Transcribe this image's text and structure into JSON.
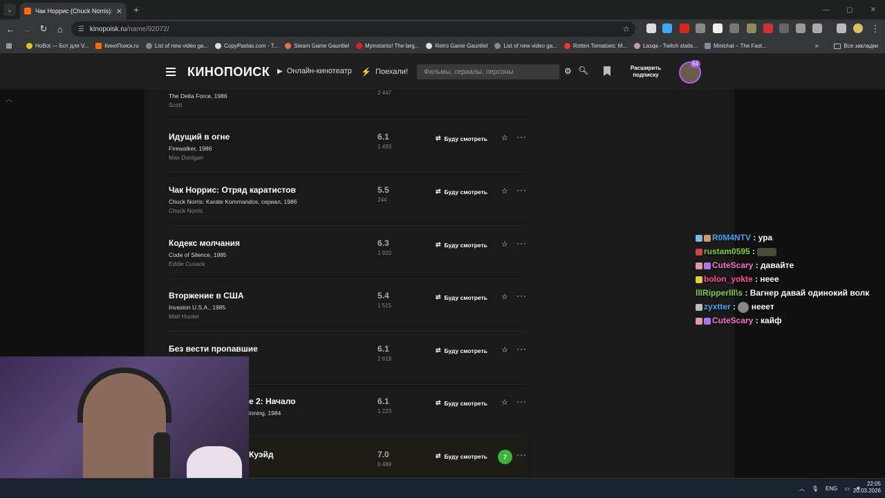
{
  "browser": {
    "tab_title": "Чак Норрис (Chuck Norris): ф",
    "tab_close": "✕",
    "new_tab": "+",
    "url_domain": "kinopoisk.ru",
    "url_path": "/name/92072/",
    "window_controls": [
      "—",
      "▢",
      "✕"
    ],
    "bookmarks": [
      "HoBot — Бот для V...",
      "КиноПоиск.ru",
      "List of new video ga...",
      "CopyPastas.com - T...",
      "Steam Game Gauntlet",
      "Myinstants! The larg...",
      "Retro Game Gauntlet",
      "List of new video ga...",
      "Rotten Tomatoes: M...",
      "Lasqa - Twitch statis...",
      "Minichat – The Fast..."
    ],
    "bookmarks_more": "»",
    "all_bookmarks": "Все закладки"
  },
  "site": {
    "logo": "КИНОПОИСК",
    "nav_online": "Онлайн-кинотеатр",
    "nav_go": "Поехали!",
    "search_placeholder": "Фильмы, сериалы, персоны",
    "subscribe_line1": "Расширить",
    "subscribe_line2": "подписку",
    "avatar_badge": "64"
  },
  "films_partial_top": {
    "orig": "The Delta Force, 1986",
    "role": "Scott",
    "votes": "2 447"
  },
  "films": [
    {
      "title": "Идущий в огне",
      "orig": "Firewalker, 1986",
      "role": "Max Donigan",
      "rating": "6.1",
      "votes": "1 493"
    },
    {
      "title": "Чак Норрис: Отряд каратистов",
      "orig": "Chuck Norris: Karate Kommandos, сериал, 1986",
      "role": "Chuck Norris",
      "rating": "5.5",
      "votes": "244"
    },
    {
      "title": "Кодекс молчания",
      "orig": "Code of Silence, 1985",
      "role": "Eddie Cusack",
      "rating": "6.3",
      "votes": "1 920"
    },
    {
      "title": "Вторжение в США",
      "orig": "Invasion U.S.A., 1985",
      "role": "Matt Hunter",
      "rating": "5.4",
      "votes": "1 515"
    },
    {
      "title": "Без вести пропавшие",
      "orig": "",
      "role": "",
      "rating": "6.1",
      "votes": "2 619"
    },
    {
      "title": "е 2: Начало",
      "orig": "inning, 1984",
      "role": "",
      "rating": "6.1",
      "votes": "1 223"
    },
    {
      "title": "Куэйд",
      "orig": "",
      "role": "",
      "rating": "7.0",
      "votes": "6 489",
      "user_score": "7"
    }
  ],
  "watch_label": "Буду смотреть",
  "chat": [
    {
      "user": "R0M4NTV",
      "color": "#3fa9f5",
      "sep": " : ",
      "msg": "ура"
    },
    {
      "user": "rustam0595",
      "color": "#7fd13b",
      "sep": " : ",
      "msg": ""
    },
    {
      "user": "CuteScary",
      "color": "#ff6fd0",
      "sep": " : ",
      "msg": "давайте"
    },
    {
      "user": "bolon_yokte",
      "color": "#ff4fa0",
      "sep": " : ",
      "msg": "неее"
    },
    {
      "user": "lllRipperlll\\s",
      "color": "#7fd13b",
      "sep": " : ",
      "msg": "Вагнер давай одинокий волк"
    },
    {
      "user": "zyxtter",
      "color": "#3fa9f5",
      "sep": " : ",
      "msg": "нееет"
    },
    {
      "user": "CuteScary",
      "color": "#ff6fd0",
      "sep": " : ",
      "msg": "кайф"
    }
  ],
  "taskbar": {
    "lang": "ENG",
    "time": "22:05",
    "date": "20.03.2026"
  }
}
